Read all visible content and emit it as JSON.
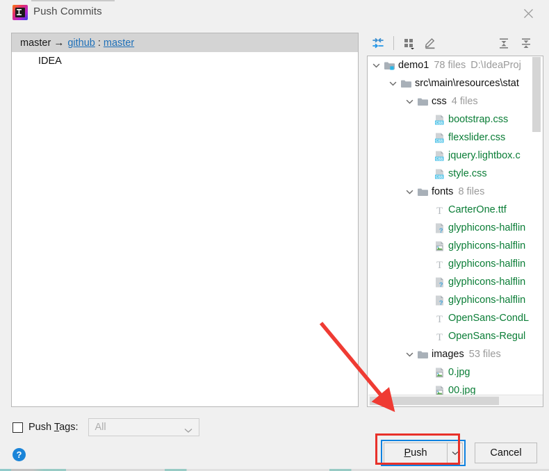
{
  "window": {
    "title": "Push Commits",
    "app_icon": "intellij-idea-icon",
    "close_icon": "close-icon"
  },
  "commits": {
    "header": {
      "local_branch": "master",
      "arrow": "→",
      "remote": "github",
      "colon": ":",
      "remote_branch": "master"
    },
    "rows": [
      {
        "message": "IDEA"
      }
    ]
  },
  "tree_toolbar": {
    "buttons": [
      {
        "name": "collapse-selection-icon",
        "tooltip": "Collapse"
      },
      {
        "name": "group-by-icon",
        "tooltip": "Group By"
      },
      {
        "name": "edit-icon",
        "tooltip": "Edit Source"
      },
      {
        "name": "expand-all-icon",
        "tooltip": "Expand All"
      },
      {
        "name": "collapse-all-icon",
        "tooltip": "Collapse All"
      }
    ]
  },
  "tree": {
    "nodes": [
      {
        "depth": 0,
        "chevron": "down",
        "icon": "module-folder-icon",
        "name": "demo1",
        "meta": "78 files",
        "meta2": "D:\\IdeaProj",
        "green": false
      },
      {
        "depth": 1,
        "chevron": "down",
        "icon": "folder-icon",
        "name": "src\\main\\resources\\stat",
        "meta": "",
        "meta2": "",
        "green": false
      },
      {
        "depth": 2,
        "chevron": "down",
        "icon": "folder-icon",
        "name": "css",
        "meta": "4 files",
        "meta2": "",
        "green": false
      },
      {
        "depth": 3,
        "chevron": "none",
        "icon": "css-file-icon",
        "name": "bootstrap.css",
        "meta": "",
        "meta2": "",
        "green": true
      },
      {
        "depth": 3,
        "chevron": "none",
        "icon": "css-file-icon",
        "name": "flexslider.css",
        "meta": "",
        "meta2": "",
        "green": true
      },
      {
        "depth": 3,
        "chevron": "none",
        "icon": "css-file-icon",
        "name": "jquery.lightbox.c",
        "meta": "",
        "meta2": "",
        "green": true
      },
      {
        "depth": 3,
        "chevron": "none",
        "icon": "css-file-icon",
        "name": "style.css",
        "meta": "",
        "meta2": "",
        "green": true
      },
      {
        "depth": 2,
        "chevron": "down",
        "icon": "folder-icon",
        "name": "fonts",
        "meta": "8 files",
        "meta2": "",
        "green": false
      },
      {
        "depth": 3,
        "chevron": "none",
        "icon": "font-file-icon",
        "name": "CarterOne.ttf",
        "meta": "",
        "meta2": "",
        "green": true
      },
      {
        "depth": 3,
        "chevron": "none",
        "icon": "unknown-file-icon",
        "name": "glyphicons-halflin",
        "meta": "",
        "meta2": "",
        "green": true
      },
      {
        "depth": 3,
        "chevron": "none",
        "icon": "image-file-icon",
        "name": "glyphicons-halflin",
        "meta": "",
        "meta2": "",
        "green": true
      },
      {
        "depth": 3,
        "chevron": "none",
        "icon": "font-file-icon",
        "name": "glyphicons-halflin",
        "meta": "",
        "meta2": "",
        "green": true
      },
      {
        "depth": 3,
        "chevron": "none",
        "icon": "unknown-file-icon",
        "name": "glyphicons-halflin",
        "meta": "",
        "meta2": "",
        "green": true
      },
      {
        "depth": 3,
        "chevron": "none",
        "icon": "unknown-file-icon",
        "name": "glyphicons-halflin",
        "meta": "",
        "meta2": "",
        "green": true
      },
      {
        "depth": 3,
        "chevron": "none",
        "icon": "font-file-icon",
        "name": "OpenSans-CondL",
        "meta": "",
        "meta2": "",
        "green": true
      },
      {
        "depth": 3,
        "chevron": "none",
        "icon": "font-file-icon",
        "name": "OpenSans-Regul",
        "meta": "",
        "meta2": "",
        "green": true
      },
      {
        "depth": 2,
        "chevron": "down",
        "icon": "folder-icon",
        "name": "images",
        "meta": "53 files",
        "meta2": "",
        "green": false
      },
      {
        "depth": 3,
        "chevron": "none",
        "icon": "image-file-icon",
        "name": "0.jpg",
        "meta": "",
        "meta2": "",
        "green": true
      },
      {
        "depth": 3,
        "chevron": "none",
        "icon": "image-file-icon",
        "name": "00.jpg",
        "meta": "",
        "meta2": "",
        "green": true
      }
    ]
  },
  "options": {
    "push_tags_label_pre": "Push ",
    "push_tags_label_mnemonic": "T",
    "push_tags_label_post": "ags:",
    "push_tags_checked": false,
    "tags_value": "All",
    "tags_disabled": true
  },
  "help": {
    "label": "?"
  },
  "buttons": {
    "push_pre": "",
    "push_mnemonic": "P",
    "push_post": "ush",
    "push_label": "Push",
    "push_dropdown_icon": "chevron-down-icon",
    "cancel_label": "Cancel"
  },
  "annotations": {
    "highlight_color": "#e8312a",
    "focus_color": "#0f82e0"
  }
}
